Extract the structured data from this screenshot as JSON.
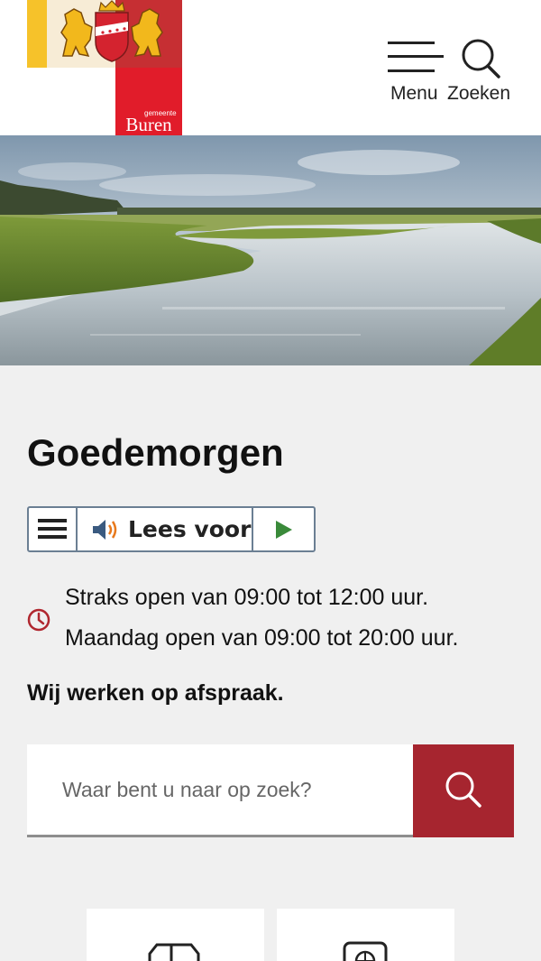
{
  "header": {
    "logo": {
      "small_text": "gemeente",
      "name": "Buren"
    },
    "menu_label": "Menu",
    "search_label": "Zoeken"
  },
  "hero": {
    "icon": "landscape-photo"
  },
  "greeting": "Goedemorgen",
  "readspeaker": {
    "label": "Lees voor",
    "menu_icon": "hamburger-icon",
    "speaker_icon": "speaker-icon",
    "play_icon": "play-icon"
  },
  "opening_hours": {
    "icon": "clock-icon",
    "today": "Straks open van 09:00 tot 12:00 uur.",
    "next": "Maandag open van 09:00 tot 20:00 uur."
  },
  "appointment_note": "Wij werken op afspraak.",
  "search": {
    "placeholder": "Waar bent u naar op zoek?",
    "button_icon": "search-icon"
  },
  "tiles": [
    {
      "icon": "car-icon"
    },
    {
      "icon": "globe-icon"
    }
  ],
  "colors": {
    "brand_red": "#a6252f",
    "logo_red": "#e11c2a",
    "logo_yellow": "#f6c22a",
    "page_bg": "#f0f0f0",
    "play_green": "#3a8a3a"
  }
}
